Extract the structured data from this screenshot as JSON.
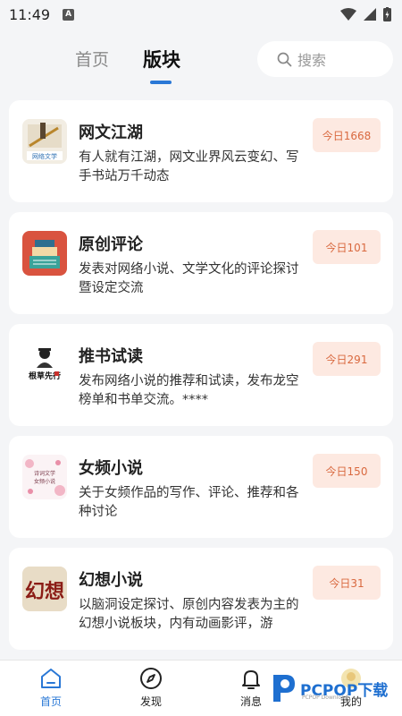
{
  "status_bar": {
    "time": "11:49",
    "indicator": "A"
  },
  "header": {
    "tabs": [
      {
        "label": "首页",
        "active": false
      },
      {
        "label": "版块",
        "active": true
      }
    ],
    "search_placeholder": "搜索",
    "accent_color": "#2a78d6"
  },
  "boards": [
    {
      "title": "网文江湖",
      "desc": "有人就有江湖，网文业界风云变幻、写手书站万千动态",
      "badge": "今日1668",
      "icon": "网络文学-icon"
    },
    {
      "title": "原创评论",
      "desc": "发表对网络小说、文学文化的评论探讨暨设定交流",
      "badge": "今日101",
      "icon": "books-icon"
    },
    {
      "title": "推书试读",
      "desc": "发布网络小说的推荐和试读，发布龙空榜单和书单交流。****",
      "badge": "今日291",
      "icon": "根草先行-icon"
    },
    {
      "title": "女频小说",
      "desc": "关于女频作品的写作、评论、推荐和各种讨论",
      "badge": "今日150",
      "icon": "female-novel-icon"
    },
    {
      "title": "幻想小说",
      "desc": "以脑洞设定探讨、原创内容发表为主的幻想小说板块，内有动画影评，游",
      "badge": "今日31",
      "icon": "幻想-icon"
    }
  ],
  "icon_texts": {
    "wangwen": "网络文学",
    "tuishu": "根草先行",
    "nvpin_1": "诗词文学",
    "nvpin_2": "女频小说",
    "huanxiang": "幻想"
  },
  "bottom_nav": [
    {
      "label": "首页",
      "active": true
    },
    {
      "label": "发现",
      "active": false
    },
    {
      "label": "消息",
      "active": false
    },
    {
      "label": "我的",
      "active": false
    }
  ],
  "watermark": {
    "brand": "PCPOP",
    "cn": "下载",
    "sub": "PCPOP Download"
  }
}
